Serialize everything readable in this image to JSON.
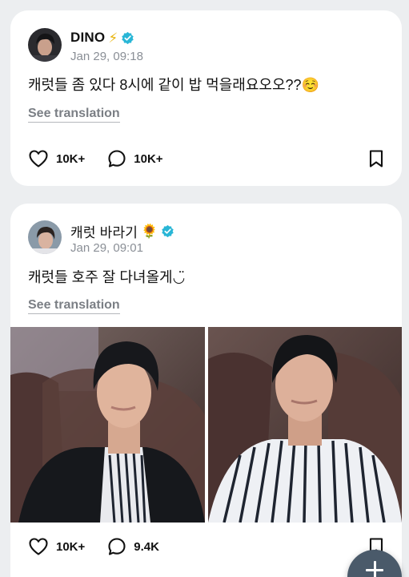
{
  "posts": [
    {
      "author": "DINO",
      "author_emoji": "⚡",
      "verified": true,
      "timestamp": "Jan 29, 09:18",
      "text": "캐럿들 좀 있다 8시에 같이 밥 먹을래요오오??☺️",
      "translate_label": "See translation",
      "likes": "10K+",
      "comments": "10K+",
      "icons": [
        "heart-icon",
        "comment-icon",
        "bookmark-icon",
        "verified-badge-icon"
      ]
    },
    {
      "author": "캐럿 바라기",
      "author_emoji": "🌻",
      "verified": true,
      "timestamp": "Jan 29, 09:01",
      "text": "캐럿들 호주 잘 다녀올게◡̈",
      "translate_label": "See translation",
      "photos": 2,
      "likes": "10K+",
      "comments": "9.4K",
      "icons": [
        "heart-icon",
        "comment-icon",
        "bookmark-icon",
        "verified-badge-icon"
      ]
    }
  ],
  "fab": {
    "icon": "plus-icon"
  },
  "colors": {
    "background": "#eceef0",
    "card": "#ffffff",
    "verified": "#29b6d6",
    "muted_text": "#8a8f96",
    "fab": "#4a5a6a"
  }
}
